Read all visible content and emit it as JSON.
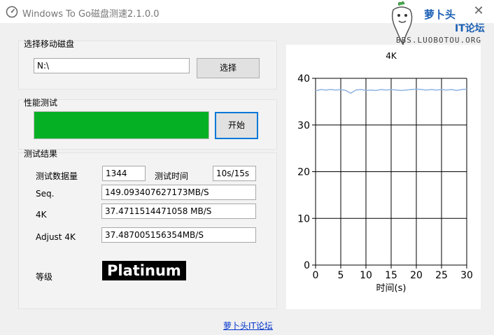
{
  "window": {
    "title": "Windows To Go磁盘测速2.1.0.0",
    "close_glyph": "✕"
  },
  "watermark": {
    "line1": "萝卜头",
    "line2": "IT论坛",
    "line3": "BBS.LUOBOTOU.ORG"
  },
  "disk_section": {
    "label": "选择移动磁盘",
    "path_value": "N:\\",
    "select_button": "选择"
  },
  "perf_section": {
    "label": "性能测试",
    "progress": 1.0,
    "start_button": "开始"
  },
  "results": {
    "label": "测试结果",
    "data_amount_label": "测试数据量",
    "data_amount_value": "1344",
    "test_time_label": "测试时间",
    "test_time_value": "10s/15s",
    "seq_label": "Seq.",
    "seq_value": "149.093407627173MB/S",
    "k4_label": "4K",
    "k4_value": "37.4711514471058 MB/S",
    "adjust_label": "Adjust 4K",
    "adjust_value": "37.487005156354MB/S",
    "grade_label": "等级",
    "grade_value": "Platinum"
  },
  "footer": {
    "link": "萝卜头IT论坛"
  },
  "colors": {
    "progress_fill": "#06b025",
    "line": "#8fb4e3",
    "link": "#0033cc"
  },
  "chart_data": {
    "type": "line",
    "title": "4K",
    "xlabel": "时间(s)",
    "ylabel": "",
    "xlim": [
      0,
      30
    ],
    "ylim": [
      0,
      40
    ],
    "xticks": [
      0,
      5,
      10,
      15,
      20,
      25,
      30
    ],
    "yticks": [
      0,
      10,
      20,
      30,
      40
    ],
    "grid": true,
    "series": [
      {
        "x": [
          0,
          1,
          2,
          3,
          4,
          5,
          6,
          7,
          8,
          9,
          10,
          11,
          12,
          13,
          14,
          15,
          16,
          17,
          18,
          19,
          20,
          21,
          22,
          23,
          24,
          25,
          26,
          27,
          28,
          29,
          30
        ],
        "values": [
          37.3,
          37.6,
          37.5,
          37.6,
          37.5,
          37.6,
          37.4,
          36.8,
          37.5,
          37.6,
          37.4,
          37.5,
          37.4,
          37.6,
          37.5,
          37.6,
          37.5,
          37.4,
          37.5,
          37.6,
          37.7,
          37.6,
          37.5,
          37.6,
          37.5,
          37.6,
          37.5,
          37.6,
          37.4,
          37.6,
          37.7
        ]
      }
    ]
  }
}
